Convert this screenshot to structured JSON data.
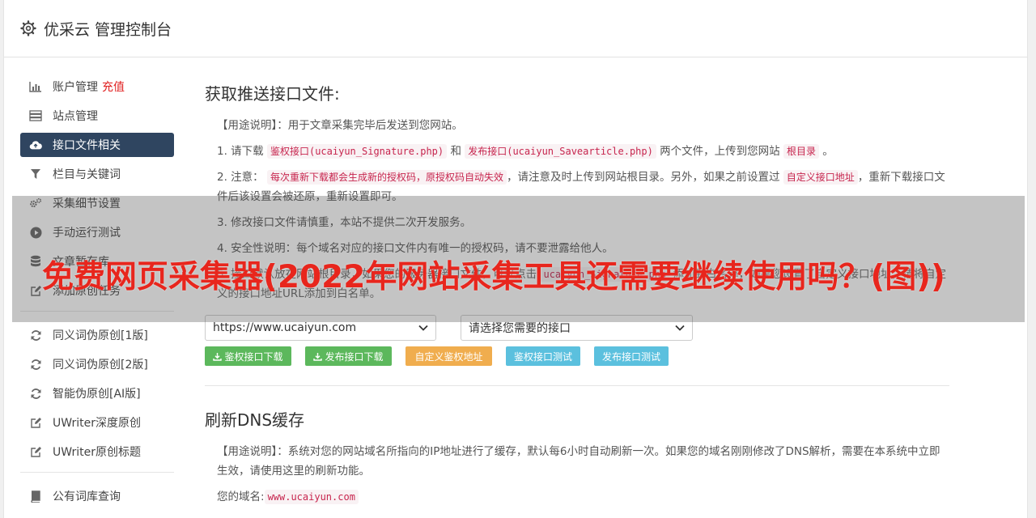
{
  "header": {
    "title": "优采云 管理控制台"
  },
  "sidebar": {
    "items": [
      {
        "label": "账户管理",
        "badge": "充值",
        "icon": "bar-chart-icon"
      },
      {
        "label": "站点管理",
        "icon": "server-icon"
      },
      {
        "label": "接口文件相关",
        "icon": "cloud-upload-icon",
        "active": true
      },
      {
        "label": "栏目与关键词",
        "icon": "filter-icon"
      },
      {
        "label": "采集细节设置",
        "icon": "cogs-icon"
      },
      {
        "label": "手动运行测试",
        "icon": "play-icon"
      },
      {
        "label": "文章暂存库",
        "icon": "database-icon"
      },
      {
        "label": "添加原创任务",
        "icon": "edit-icon"
      }
    ],
    "items2": [
      {
        "label": "同义词伪原创[1版]",
        "icon": "refresh-icon"
      },
      {
        "label": "同义词伪原创[2版]",
        "icon": "refresh-icon"
      },
      {
        "label": "智能伪原创[AI版]",
        "icon": "refresh-icon"
      },
      {
        "label": "UWriter深度原创",
        "icon": "edit-icon"
      },
      {
        "label": "UWriter原创标题",
        "icon": "edit-icon"
      }
    ],
    "items3": [
      {
        "label": "公有词库查询",
        "icon": "book-icon"
      }
    ]
  },
  "main": {
    "section1": {
      "title": "获取推送接口文件:",
      "usage_label": "【用途说明】",
      "usage_text": "：用于文章采集完毕后发送到您网站。",
      "step1_pre": "1. 请下载",
      "step1_code1": "鉴权接口(ucaiyun_Signature.php)",
      "step1_mid": "和",
      "step1_code2": "发布接口(ucaiyun_Savearticle.php)",
      "step1_post": "两个文件，上传到您网站",
      "step1_code3": "根目录",
      "step1_end": "。",
      "step2_pre": "2. 注意：",
      "step2_code1": "每次重新下载都会生成新的授权码，原授权码自动失效",
      "step2_mid": "，请注意及时上传到网站根目录。另外，如果之前设置过",
      "step2_code2": "自定义接口地址",
      "step2_post": "，重新下载接口文件后该设置会被还原，重新设置即可。",
      "step3": "3. 修改接口文件请慎重，本站不提供二次开发服务。",
      "step4": "4. 安全性说明：每个域名对应的接口文件内有唯一的授权码，请不要泄露给他人。",
      "step5_pre": "5. 接口默认放在网站根目录，如果您的服务器接口文件，可以点击",
      "step5_code": "ucaiyun_Signature.php",
      "step5_post": "添加到白名单，如果您设置了自定义接口地址，请将自定义的接口地址URL添加到白名单。",
      "domain_select": "https://www.ucaiyun.com",
      "interface_select": "请选择您需要的接口",
      "buttons": {
        "auth_download": "鉴权接口下载",
        "publish_download": "发布接口下载",
        "custom_auth": "自定义鉴权地址",
        "auth_test": "鉴权接口测试",
        "publish_test": "发布接口测试"
      }
    },
    "section2": {
      "title": "刷新DNS缓存",
      "usage_label": "【用途说明】",
      "usage_text": "：系统对您的网站域名所指向的IP地址进行了缓存，默认每6小时自动刷新一次。如果您的域名刚刚修改了DNS解析，需要在本系统中立即生效，请使用这里的刷新功能。",
      "domain_label": "您的域名:",
      "domain_value": "www.ucaiyun.com"
    }
  },
  "overlay": {
    "banner": "免费网页采集器(2022年网站采集工具还需要继续使用吗？(图))"
  },
  "colors": {
    "active_nav": "#2f4560",
    "green_button": "#5cb85c",
    "orange_button": "#f0ad4e",
    "blue_button": "#5bc0de",
    "code_text": "#c7254e",
    "banner_text": "#e8261d",
    "badge_text": "#e02020"
  }
}
